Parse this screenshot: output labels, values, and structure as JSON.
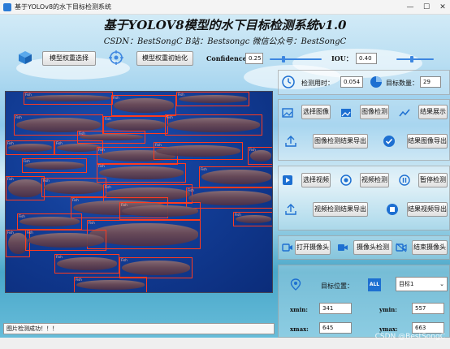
{
  "window": {
    "title": "基于YOLOv8的水下目标检测系统"
  },
  "header": {
    "title": "基于YOLOV8模型的水下目标检测系统v1.0",
    "subtitle": "CSDN：BestSongC   B站：Bestsongc   微信公众号：BestSongC"
  },
  "toolbar": {
    "select_weights": "模型权重选择",
    "init_weights": "模型权重初始化",
    "confidence_label": "Confidence:",
    "confidence_value": "0.25",
    "confidence_slider_value": 0.25,
    "iou_label": "IOU：",
    "iou_value": "0.40",
    "iou_slider_value": 0.4
  },
  "stats": {
    "time_label": "检测用时：",
    "time_value": "0.054",
    "count_label": "目标数量：",
    "count_value": "29"
  },
  "image_row": {
    "select_image": "选择图像",
    "detect_image": "图像检测",
    "show_result": "结果展示"
  },
  "export_row": {
    "export_image_result": "图像检测结果导出",
    "export_image": "结果图像导出"
  },
  "video_row": {
    "select_video": "选择视频",
    "detect_video": "视频检测",
    "pause_detect": "暂停检测"
  },
  "video_export_row": {
    "export_video_result": "视频检测结果导出",
    "export_video": "结果视频导出"
  },
  "camera_row": {
    "open_camera": "打开摄像头",
    "detect_camera": "摄像头检测",
    "close_camera": "结束摄像头"
  },
  "target": {
    "position_label": "目标位置：",
    "all_label": "ALL",
    "selected": "目标1",
    "xmin_label": "xmin:",
    "xmin_value": "341",
    "ymin_label": "ymin:",
    "ymin_value": "557",
    "xmax_label": "xmax:",
    "xmax_value": "645",
    "ymax_label": "ymax:",
    "ymax_value": "663"
  },
  "status": {
    "text": "图片检测成功！！！"
  },
  "watermark": "CSDN @BestSongC",
  "detection": {
    "class_name": "Fish"
  },
  "colors": {
    "accent": "#3d86e0",
    "box": "#ff3b1e",
    "water": "#123d96"
  }
}
